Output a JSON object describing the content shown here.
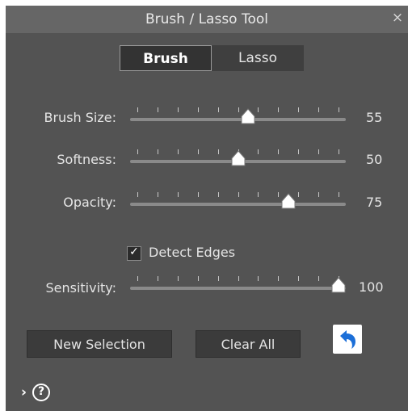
{
  "window": {
    "title": "Brush / Lasso Tool",
    "close_glyph": "×"
  },
  "tabs": [
    {
      "label": "Brush",
      "active": true
    },
    {
      "label": "Lasso",
      "active": false
    }
  ],
  "sliders": [
    {
      "label": "Brush Size:",
      "value": "55",
      "fraction": 0.55
    },
    {
      "label": "Softness:",
      "value": "50",
      "fraction": 0.5
    },
    {
      "label": "Opacity:",
      "value": "75",
      "fraction": 0.75
    }
  ],
  "detect_edges": {
    "label": "Detect Edges",
    "checked": true,
    "check_glyph": "✓"
  },
  "sensitivity": {
    "label": "Sensitivity:",
    "value": "100",
    "fraction": 1.0
  },
  "buttons": {
    "new_selection": "New Selection",
    "clear_all": "Clear All"
  },
  "footer": {
    "expand_glyph": "›",
    "help_glyph": "?"
  },
  "icons": {
    "undo": "undo-arrow-icon",
    "help": "help-circle-icon"
  },
  "colors": {
    "panel": "#535353",
    "titlebar": "#666666",
    "undo_arrow": "#1c6fd8"
  }
}
